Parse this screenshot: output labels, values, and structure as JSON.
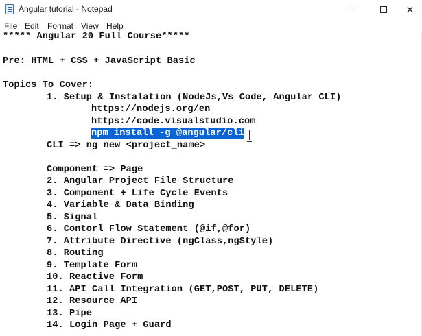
{
  "window": {
    "title": "Angular tutorial - Notepad",
    "minimize_icon": "minimize-icon",
    "maximize_icon": "maximize-icon",
    "close_glyph": "✕"
  },
  "menu": {
    "items": [
      "File",
      "Edit",
      "Format",
      "View",
      "Help"
    ]
  },
  "document": {
    "heading": "***** Angular 20 Full Course*****",
    "prereq": "Pre: HTML + CSS + JavaScript Basic",
    "topics_heading": "Topics To Cover:",
    "setup": "1. Setup & Instalation (NodeJs,Vs Code, Angular CLI)",
    "url_node": "https://nodejs.org/en",
    "url_vscode": "https://code.visualstudio.com",
    "npm_cmd": "npm install -g @angular/cli",
    "cli_cmd": "CLI => ng new <project_name>",
    "component": "Component => Page",
    "topics": [
      "2. Angular Project File Structure",
      "3. Component + Life Cycle Events",
      "4. Variable & Data Binding",
      "5. Signal",
      "6. Contorl Flow Statement (@if,@for)",
      "7. Attribute Directive (ngClass,ngStyle)",
      "8. Routing",
      "9. Template Form",
      "10. Reactive Form",
      "11. API Call Integration (GET,POST, PUT, DELETE)",
      "12. Resource API",
      "13. Pipe",
      "14. Login Page + Guard"
    ],
    "selection_color": "#0a64d6"
  }
}
